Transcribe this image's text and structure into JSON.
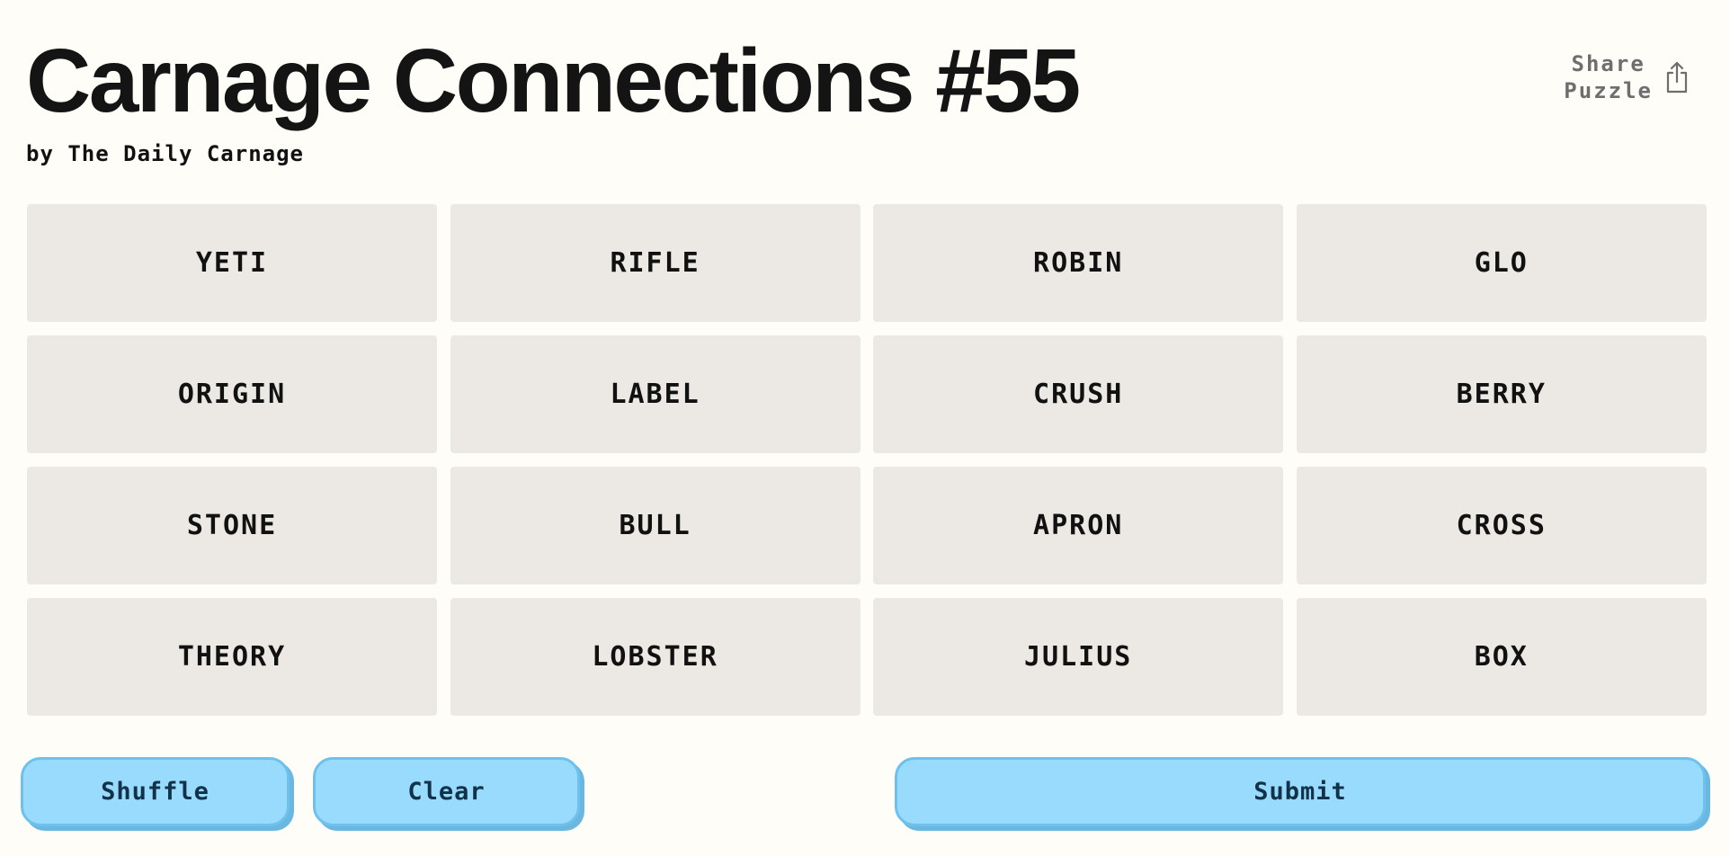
{
  "header": {
    "title": "Carnage Connections #55",
    "byline": "by The Daily Carnage",
    "share_line1": "Share",
    "share_line2": "Puzzle",
    "share_icon": "share-icon"
  },
  "board": {
    "tiles": [
      "YETI",
      "RIFLE",
      "ROBIN",
      "GLO",
      "ORIGIN",
      "LABEL",
      "CRUSH",
      "BERRY",
      "STONE",
      "BULL",
      "APRON",
      "CROSS",
      "THEORY",
      "LOBSTER",
      "JULIUS",
      "BOX"
    ]
  },
  "controls": {
    "shuffle_label": "Shuffle",
    "clear_label": "Clear",
    "submit_label": "Submit"
  },
  "colors": {
    "background": "#fffdf8",
    "tile": "#ece9e4",
    "button": "#99dbfd",
    "button_border": "#6ec1ec",
    "button_text": "#12324a"
  }
}
